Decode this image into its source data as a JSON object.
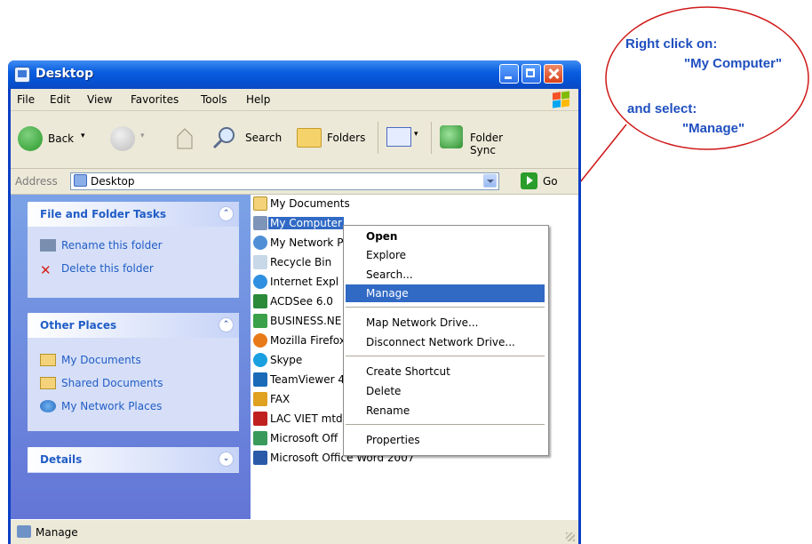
{
  "window": {
    "title": "Desktop"
  },
  "menu": [
    "File",
    "Edit",
    "View",
    "Favorites",
    "Tools",
    "Help"
  ],
  "toolbar": {
    "back": "Back",
    "search": "Search",
    "folders": "Folders",
    "folder_sync": "Folder Sync"
  },
  "address": {
    "label": "Address",
    "value": "Desktop",
    "go": "Go"
  },
  "tasks": {
    "file_folder": {
      "title": "File and Folder Tasks",
      "items": [
        "Rename this folder",
        "Delete this folder"
      ]
    },
    "other_places": {
      "title": "Other Places",
      "items": [
        "My Documents",
        "Shared Documents",
        "My Network Places"
      ]
    },
    "details": {
      "title": "Details"
    }
  },
  "files": [
    "My Documents",
    "My Computer",
    "My Network P",
    "Recycle Bin",
    "Internet Expl",
    "ACDSee 6.0",
    "BUSINESS.NE",
    "Mozilla Firefox",
    "Skype",
    "TeamViewer 4",
    "FAX",
    "LAC VIET mtd",
    "Microsoft Off",
    "Microsoft Office Word 2007"
  ],
  "selected_file": "My Computer",
  "context_menu": {
    "open": "Open",
    "explore": "Explore",
    "search": "Search...",
    "manage": "Manage",
    "map_drive": "Map Network Drive...",
    "disconnect_drive": "Disconnect Network Drive...",
    "create_shortcut": "Create Shortcut",
    "delete": "Delete",
    "rename": "Rename",
    "properties": "Properties"
  },
  "status": {
    "text": "Manage"
  },
  "annotation": {
    "line1": "Right click on:",
    "line2": "\"My Computer\"",
    "line3": "and select:",
    "line4": "\"Manage\"",
    "color": "#1f4fbf",
    "circle_color": "#d01818"
  },
  "colors": {
    "title_bar": "#0a5ee0",
    "task_pane": "#6f8de0",
    "highlight": "#316ac5"
  }
}
